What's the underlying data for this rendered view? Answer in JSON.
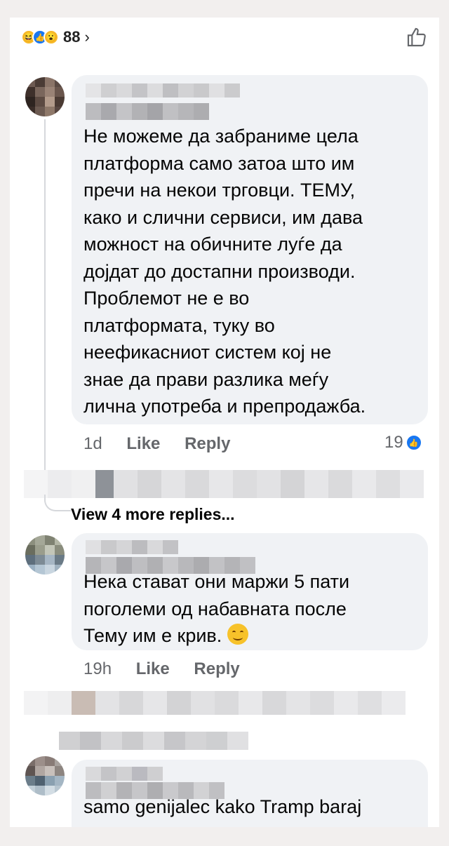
{
  "header": {
    "reaction_count": "88",
    "reaction_icons": [
      "haha-icon",
      "like-icon",
      "wow-icon"
    ]
  },
  "comments": [
    {
      "text": "Не можеме да забраниме цела платформа само затоа што им пречи на некои трговци. ТЕМУ, како и слични сервиси, им дава можност на обичните луѓе да дојдат до достапни производи. Проблемот не е во платформата, туку во неефикасниот систем кој не знае да прави разлика меѓу лична употреба и препродажба.",
      "lines": [
        "Не можеме да забраниме цела",
        "платформа само затоа што им",
        "пречи на некои трговци. ТЕМУ,",
        "како и слични сервиси, им дава",
        "можност на обичните луѓе да",
        "дојдат до достапни производи.",
        "Проблемот не е во",
        "платформата, туку во",
        "неефикасниот систем кој не",
        "знае да прави разлика меѓу",
        "лична употреба и препродажба."
      ],
      "time": "1d",
      "like_label": "Like",
      "reply_label": "Reply",
      "like_count": "19"
    },
    {
      "lines": [
        "Нека стават они маржи 5 пати",
        "поголеми од набавната после",
        "Тему им е крив."
      ],
      "time": "19h",
      "like_label": "Like",
      "reply_label": "Reply"
    },
    {
      "lines": [
        "samo genijalec kako Tramp baraj"
      ]
    }
  ],
  "view_more": "View 4 more replies..."
}
